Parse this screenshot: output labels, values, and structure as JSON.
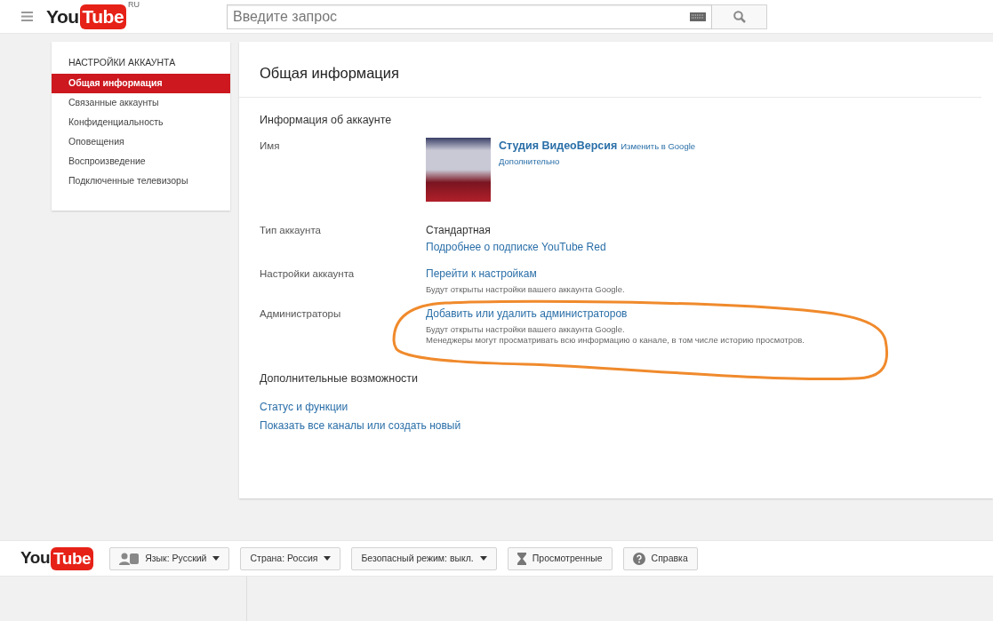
{
  "header": {
    "logo": {
      "you": "You",
      "tube": "Tube"
    },
    "region": "RU",
    "search": {
      "placeholder": "Введите запрос"
    }
  },
  "sidebar": {
    "heading": "НАСТРОЙКИ АККАУНТА",
    "items": [
      {
        "label": "Общая информация",
        "selected": true
      },
      {
        "label": "Связанные аккаунты",
        "selected": false
      },
      {
        "label": "Конфиденциальность",
        "selected": false
      },
      {
        "label": "Оповещения",
        "selected": false
      },
      {
        "label": "Воспроизведение",
        "selected": false
      },
      {
        "label": "Подключенные телевизоры",
        "selected": false
      }
    ]
  },
  "main": {
    "title": "Общая информация",
    "section_title": "Информация об аккаунте",
    "rows": [
      {
        "kind": "profile",
        "label": "Имя",
        "name": "Студия ВидеоВерсия",
        "edit_link": "Изменить в Google",
        "more_link": "Дополнительно"
      },
      {
        "kind": "text_link",
        "label": "Тип аккаунта",
        "text": "Стандартная",
        "link": "Подробнее о подписке YouTube Red"
      },
      {
        "kind": "link_notes",
        "label": "Настройки аккаунта",
        "link": "Перейти к настройкам",
        "notes": [
          "Будут открыты настройки вашего аккаунта Google."
        ]
      },
      {
        "kind": "link_notes",
        "label": "Администраторы",
        "link": "Добавить или удалить администраторов",
        "notes": [
          "Будут открыты настройки вашего аккаунта Google.",
          "Менеджеры могут просматривать всю информацию о канале, в том числе историю просмотров."
        ]
      }
    ],
    "extra_title": "Дополнительные возможности",
    "extra_links": [
      "Статус и функции",
      "Показать все каналы или создать новый"
    ]
  },
  "footer": {
    "logo": {
      "you": "You",
      "tube": "Tube"
    },
    "buttons": [
      {
        "kind": "language",
        "label": "Язык: Русский"
      },
      {
        "kind": "dropdown",
        "label": "Страна: Россия"
      },
      {
        "kind": "dropdown",
        "label": "Безопасный режим: выкл."
      },
      {
        "kind": "history",
        "label": "Просмотренные"
      },
      {
        "kind": "help",
        "label": "Справка"
      }
    ]
  }
}
